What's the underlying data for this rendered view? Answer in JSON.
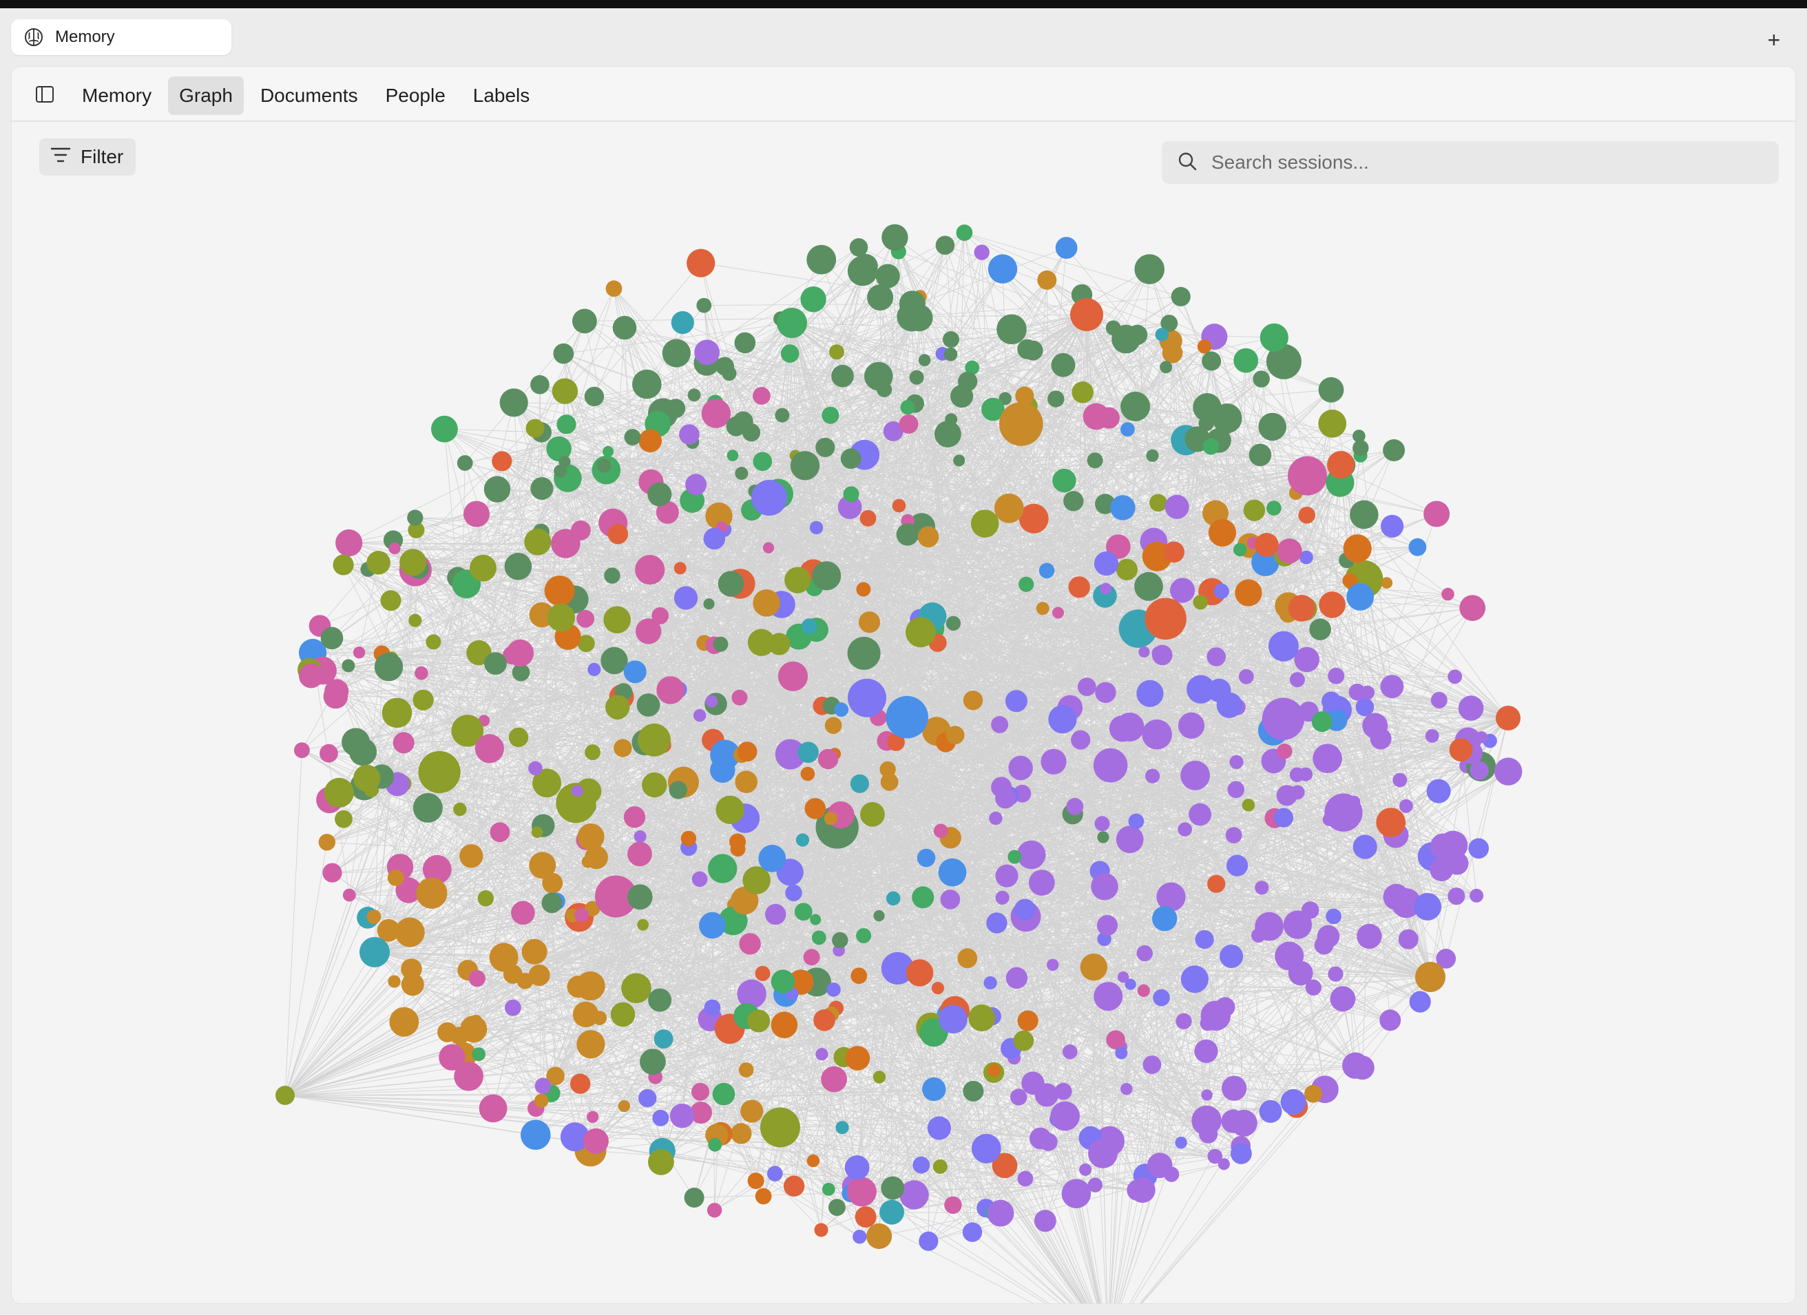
{
  "window": {
    "tab_title": "Memory",
    "new_tab_label": "+"
  },
  "nav": {
    "tabs": [
      {
        "label": "Memory",
        "active": false
      },
      {
        "label": "Graph",
        "active": true
      },
      {
        "label": "Documents",
        "active": false
      },
      {
        "label": "People",
        "active": false
      },
      {
        "label": "Labels",
        "active": false
      }
    ]
  },
  "toolbar": {
    "filter_label": "Filter",
    "search_placeholder": "Search sessions..."
  },
  "graph": {
    "node_colors": [
      "#5b8f62",
      "#a56ee0",
      "#4a90e8",
      "#8d9e2a",
      "#d6721e",
      "#d05fa6",
      "#7e76f2",
      "#44aa64",
      "#3aa4b4",
      "#c98a2a",
      "#e0623a"
    ],
    "hub_color": "#5b8f62",
    "edge_color": "#2a2a2a",
    "icons": {
      "filter": "filter-lines-icon",
      "search": "search-icon",
      "sidebar": "sidebar-toggle-icon",
      "app": "brain-icon"
    }
  }
}
